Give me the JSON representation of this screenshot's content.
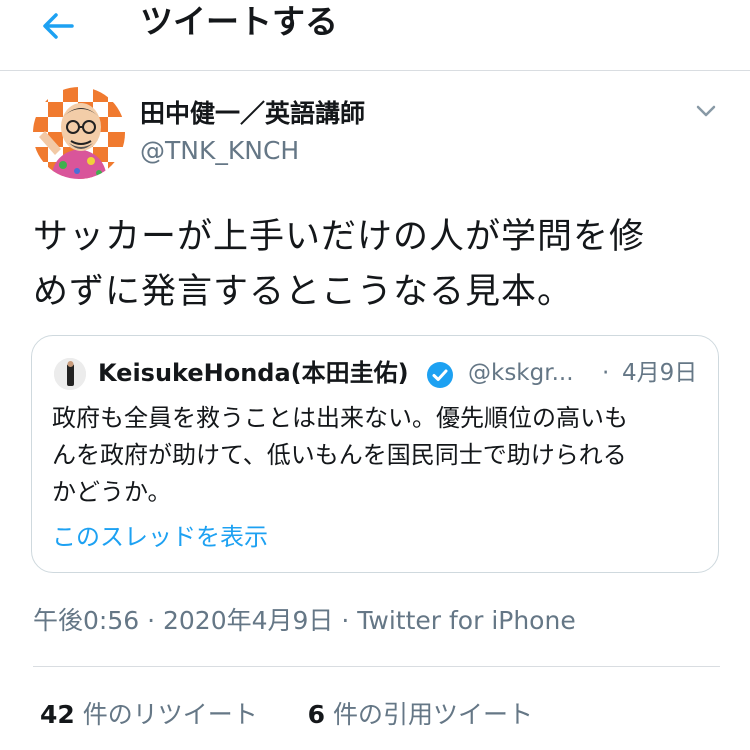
{
  "header": {
    "title": "ツイートする",
    "back_icon": "arrow-left-icon",
    "accent": "#1da1f2"
  },
  "author": {
    "name": "田中健一／英語講師",
    "handle": "@TNK_KNCH"
  },
  "tweet": {
    "text_line1": "サッカーが上手いだけの人が学問を修",
    "text_line2": "めずに発言するとこうなる見本。"
  },
  "quote": {
    "name": "KeisukeHonda(本田圭佑)",
    "handle": "@kskgr...",
    "separator": "·",
    "date": "4月9日",
    "text_line1": "政府も全員を救うことは出来ない。優先順位の高いも",
    "text_line2": "んを政府が助けて、低いもんを国民同士で助けられる",
    "text_line3": "かどうか。",
    "link": "このスレッドを表示"
  },
  "meta": {
    "text": "午後0:56 · 2020年4月9日 · Twitter for iPhone"
  },
  "stats": {
    "retweets_count": "42",
    "retweets_label": "件のリツイート",
    "quotes_count": "6",
    "quotes_label": "件の引用ツイート"
  }
}
